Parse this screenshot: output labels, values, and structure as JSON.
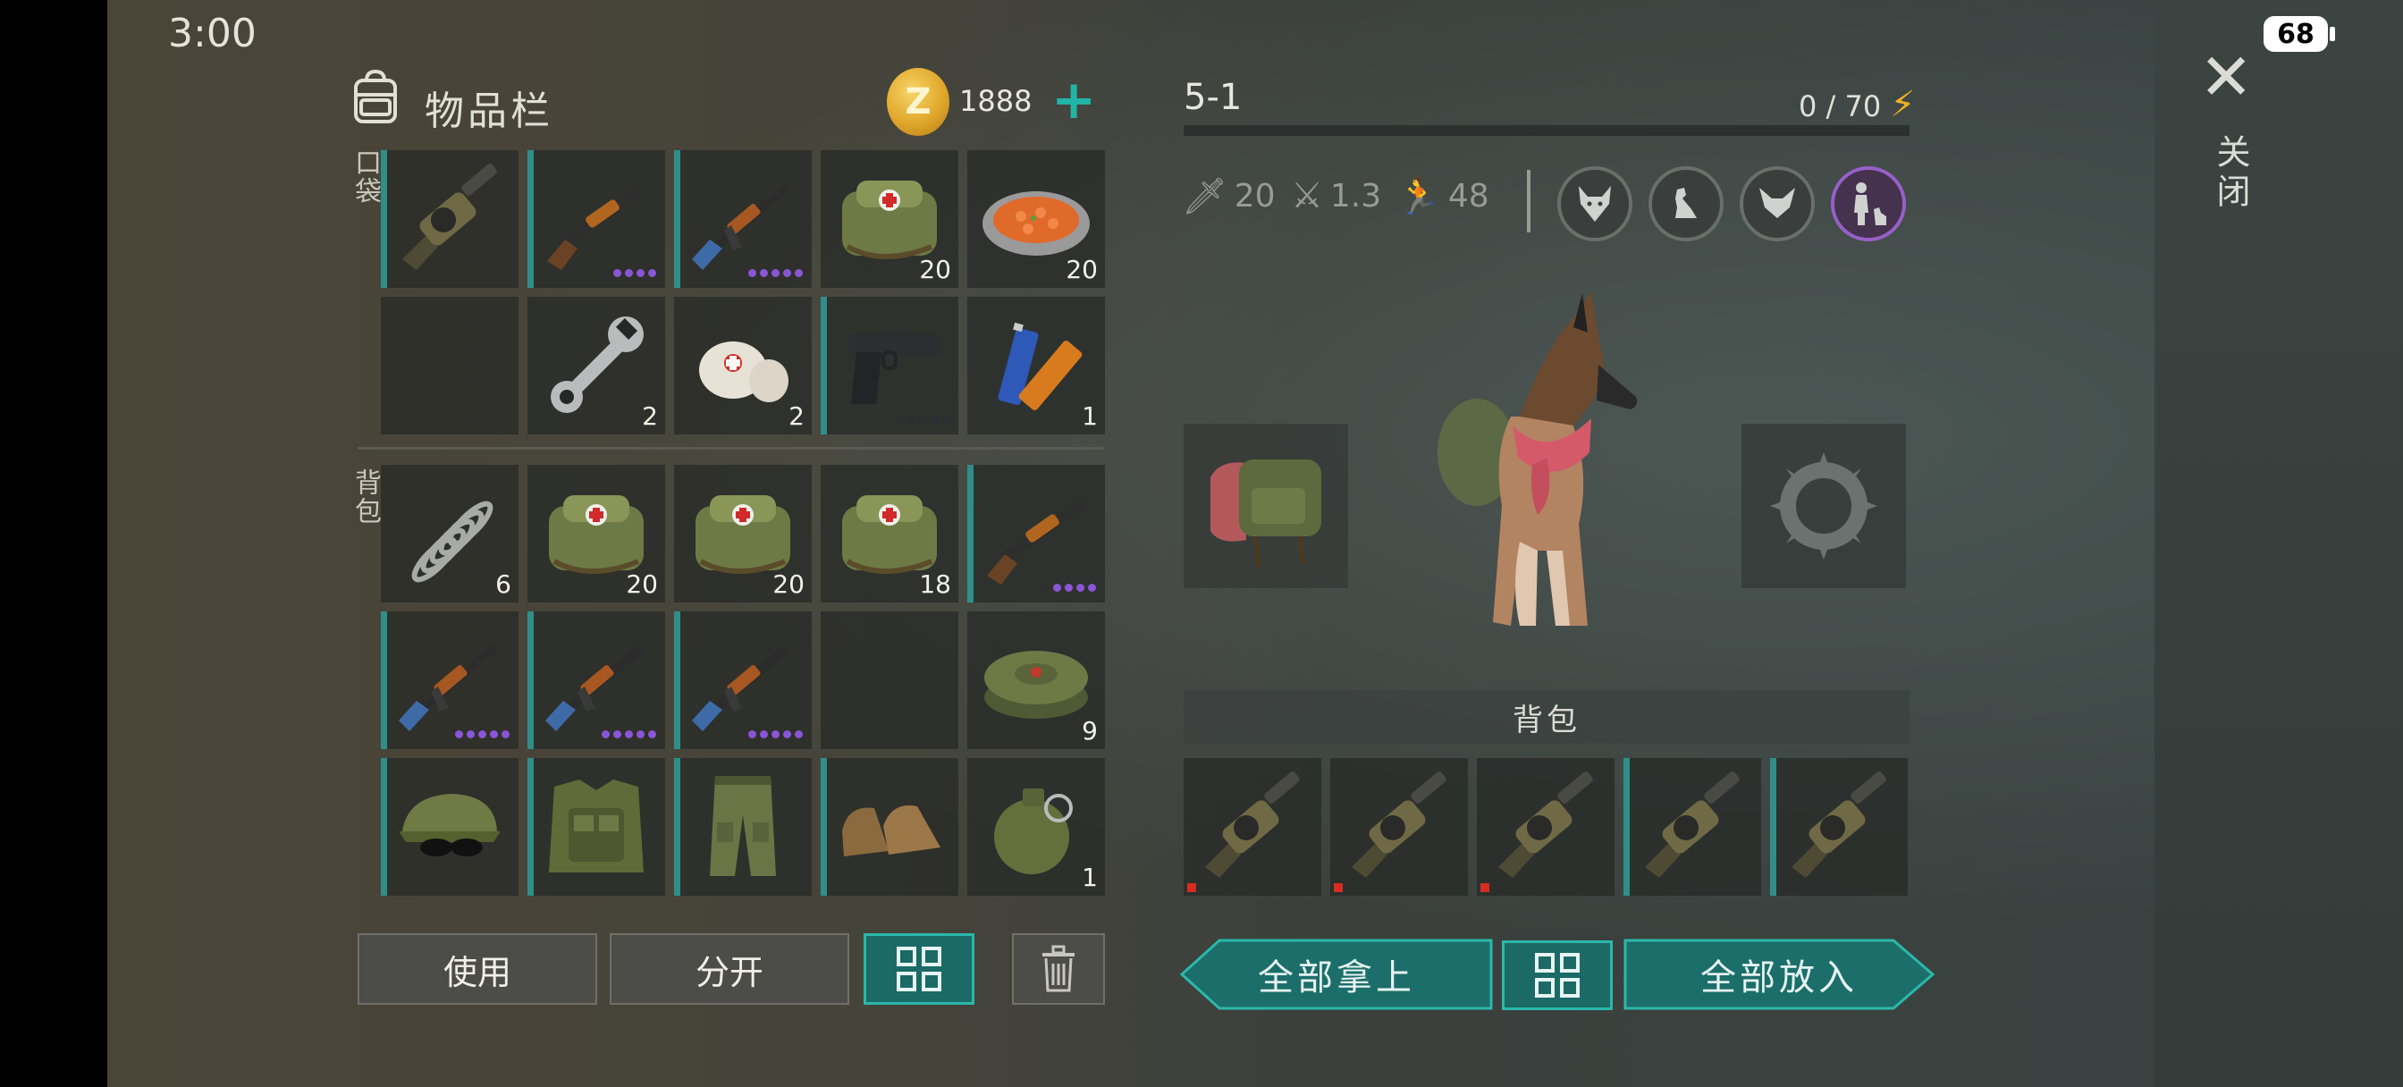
{
  "status_bar": {
    "time": "3:00",
    "battery": "68"
  },
  "inventory": {
    "title": "物品栏",
    "coins": "1888",
    "pocket_label": "口袋",
    "backpack_label": "背包",
    "pocket": [
      {
        "icon": "grenade-launcher-icon",
        "count": "",
        "dots": 0,
        "accent": true
      },
      {
        "icon": "shotgun-icon",
        "count": "",
        "dots": 5,
        "dots_on": 4,
        "accent": true
      },
      {
        "icon": "assault-rifle-icon",
        "count": "",
        "dots": 5,
        "dots_on": 5,
        "accent": true
      },
      {
        "icon": "medkit-bag-icon",
        "count": "20",
        "dots": 0,
        "accent": false
      },
      {
        "icon": "food-bowl-icon",
        "count": "20",
        "dots": 0,
        "accent": false
      },
      {
        "icon": "",
        "count": "",
        "dots": 0,
        "accent": false
      },
      {
        "icon": "wrench-icon",
        "count": "2",
        "dots": 0,
        "accent": false
      },
      {
        "icon": "bandage-icon",
        "count": "2",
        "dots": 0,
        "accent": false
      },
      {
        "icon": "pistol-icon",
        "count": "",
        "dots": 5,
        "dots_on": 0,
        "accent": true
      },
      {
        "icon": "batteries-icon",
        "count": "1",
        "dots": 0,
        "accent": false
      }
    ],
    "backpack": [
      {
        "icon": "spring-icon",
        "count": "6",
        "dots": 0,
        "accent": false
      },
      {
        "icon": "medkit-bag-icon",
        "count": "20",
        "dots": 0,
        "accent": false
      },
      {
        "icon": "medkit-bag-icon",
        "count": "20",
        "dots": 0,
        "accent": false
      },
      {
        "icon": "medkit-bag-icon",
        "count": "18",
        "dots": 0,
        "accent": false
      },
      {
        "icon": "shotgun-icon",
        "count": "",
        "dots": 5,
        "dots_on": 4,
        "accent": true
      },
      {
        "icon": "assault-rifle-icon",
        "count": "",
        "dots": 5,
        "dots_on": 5,
        "accent": true
      },
      {
        "icon": "assault-rifle-icon",
        "count": "",
        "dots": 5,
        "dots_on": 5,
        "accent": true
      },
      {
        "icon": "assault-rifle-icon",
        "count": "",
        "dots": 5,
        "dots_on": 5,
        "accent": true
      },
      {
        "icon": "",
        "count": "",
        "dots": 0,
        "accent": false
      },
      {
        "icon": "landmine-icon",
        "count": "9",
        "dots": 0,
        "accent": false
      },
      {
        "icon": "camo-cap-icon",
        "count": "",
        "dots": 0,
        "accent": true
      },
      {
        "icon": "tactical-vest-icon",
        "count": "",
        "dots": 0,
        "accent": true
      },
      {
        "icon": "camo-pants-icon",
        "count": "",
        "dots": 0,
        "accent": true
      },
      {
        "icon": "boots-icon",
        "count": "",
        "dots": 0,
        "accent": true
      },
      {
        "icon": "frag-grenade-icon",
        "count": "1",
        "dots": 0,
        "accent": false
      }
    ],
    "buttons": {
      "use": "使用",
      "split": "分开"
    }
  },
  "pet": {
    "level": "5-1",
    "energy": "0 / 70",
    "stats": {
      "attack": "20",
      "attack_speed": "1.3",
      "speed": "48"
    },
    "skills": [
      "wolf-head-icon",
      "sitting-dog-icon",
      "fox-head-icon",
      "dog-trainer-icon"
    ],
    "backpack_label": "背包",
    "storage": [
      "grenade-launcher-icon",
      "grenade-launcher-icon",
      "grenade-launcher-icon",
      "grenade-launcher-icon",
      "grenade-launcher-icon"
    ],
    "buttons": {
      "take_all": "全部拿上",
      "put_all": "全部放入"
    }
  },
  "close": {
    "label": "关闭"
  },
  "colors": {
    "teal": "#2bb8ab",
    "accent_bar": "#2f8f88",
    "rarity_purple": "#8a55d6"
  }
}
